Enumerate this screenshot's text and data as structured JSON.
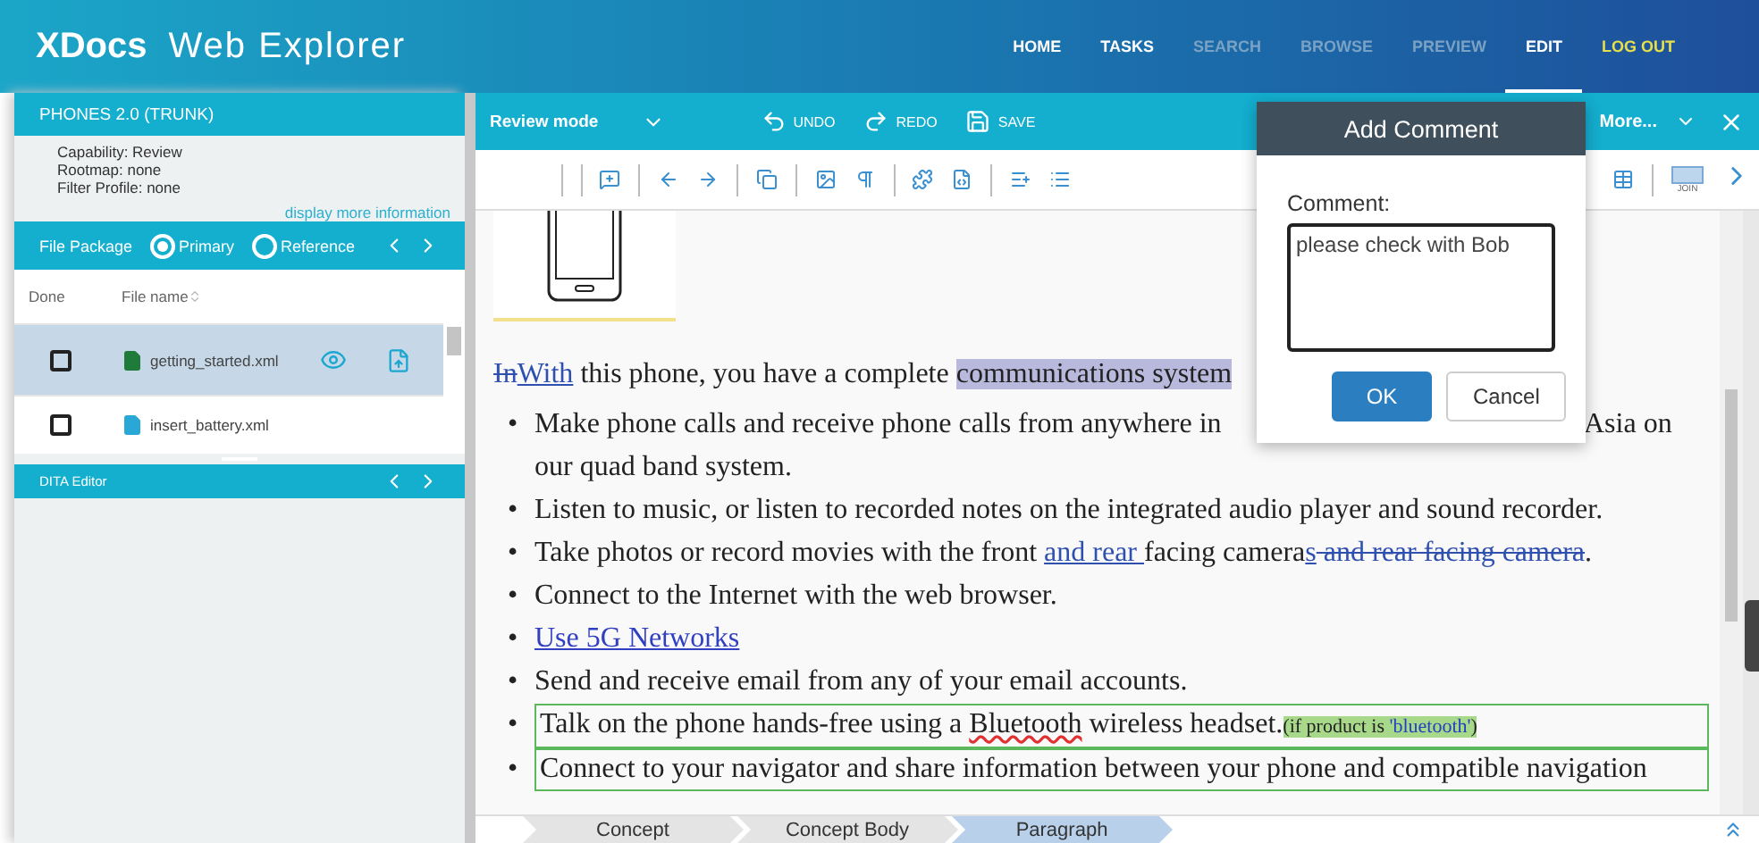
{
  "header": {
    "brand": "XDocs",
    "product": "Web Explorer",
    "nav": [
      {
        "label": "HOME",
        "selected": false,
        "disabled": false,
        "kind": "link"
      },
      {
        "label": "TASKS",
        "selected": false,
        "disabled": false,
        "kind": "link"
      },
      {
        "label": "SEARCH",
        "selected": false,
        "disabled": true,
        "kind": "link"
      },
      {
        "label": "BROWSE",
        "selected": false,
        "disabled": true,
        "kind": "link"
      },
      {
        "label": "PREVIEW",
        "selected": false,
        "disabled": true,
        "kind": "link"
      },
      {
        "label": "EDIT",
        "selected": true,
        "disabled": false,
        "kind": "link"
      },
      {
        "label": "LOG OUT",
        "selected": false,
        "disabled": false,
        "kind": "logout"
      }
    ]
  },
  "project": {
    "title": "PHONES 2.0 (TRUNK)",
    "info": [
      "Capability: Review",
      "Rootmap: none",
      "Filter Profile: none"
    ],
    "more_link": "display more information"
  },
  "file_package": {
    "label": "File Package",
    "options": [
      {
        "label": "Primary",
        "selected": true
      },
      {
        "label": "Reference",
        "selected": false
      }
    ]
  },
  "files": {
    "columns": [
      "Done",
      "File name"
    ],
    "rows": [
      {
        "name": "getting_started.xml",
        "done": false,
        "selected": true,
        "color": "#1e7b3a"
      },
      {
        "name": "insert_battery.xml",
        "done": false,
        "selected": false,
        "color": "#29a8d8"
      }
    ]
  },
  "dita_editor": {
    "title": "DITA Editor"
  },
  "editor_bar": {
    "mode": "Review mode",
    "actions": [
      {
        "label": "UNDO",
        "kind": "undo"
      },
      {
        "label": "REDO",
        "kind": "redo"
      },
      {
        "label": "SAVE",
        "kind": "save"
      }
    ],
    "more": "More..."
  },
  "toolbar": {
    "join": "JOIN"
  },
  "document": {
    "intro": [
      {
        "t": "In",
        "kind": "deleted"
      },
      {
        "t": "With",
        "kind": "inserted"
      },
      {
        "t": " this phone, you have a complete ",
        "kind": "plain"
      },
      {
        "t": "communications system",
        "kind": "highlight"
      }
    ],
    "bullets": [
      {
        "marker": "•",
        "boxed": false,
        "runs": [
          {
            "t": "Make phone calls and receive phone calls from anywhere in",
            "kind": "plain"
          }
        ],
        "after_dialog": [
          {
            "t": "Asia on our quad band system.",
            "kind": "plain"
          }
        ]
      },
      {
        "marker": "•",
        "boxed": false,
        "runs": [
          {
            "t": "Listen to music, or listen to recorded notes on the integrated audio player and sound recorder.",
            "kind": "plain"
          }
        ]
      },
      {
        "marker": "•",
        "boxed": false,
        "runs": [
          {
            "t": "Take photos or record movies with the front ",
            "kind": "plain"
          },
          {
            "t": "and rear ",
            "kind": "inserted"
          },
          {
            "t": "facing camera",
            "kind": "plain"
          },
          {
            "t": "s",
            "kind": "inserted"
          },
          {
            "t": " and rear facing camera",
            "kind": "deleted"
          },
          {
            "t": ".",
            "kind": "plain"
          }
        ]
      },
      {
        "marker": "•",
        "boxed": false,
        "runs": [
          {
            "t": "Connect to the Internet with the web browser.",
            "kind": "plain"
          }
        ]
      },
      {
        "marker": "•",
        "boxed": false,
        "runs": [
          {
            "t": "Use 5G Networks",
            "kind": "link"
          }
        ]
      },
      {
        "marker": "•",
        "boxed": false,
        "runs": [
          {
            "t": "Send and receive email from any of your email accounts.",
            "kind": "plain"
          }
        ]
      },
      {
        "marker": "•",
        "boxed": true,
        "runs": [
          {
            "t": "Talk on the phone hands-free using a ",
            "kind": "plain"
          },
          {
            "t": "Bluetooth",
            "kind": "misspelled"
          },
          {
            "t": " wireless headset.",
            "kind": "plain"
          },
          {
            "t": "(if product is ",
            "kind": "condition"
          },
          {
            "t": "'bluetooth'",
            "kind": "condition-value"
          },
          {
            "t": ")",
            "kind": "condition"
          }
        ]
      },
      {
        "marker": "•",
        "boxed": true,
        "runs": [
          {
            "t": "Connect to your navigator and share information between your phone and compatible navigation",
            "kind": "plain"
          }
        ]
      }
    ]
  },
  "dialog": {
    "title": "Add Comment",
    "label": "Comment:",
    "value": "please check with Bob",
    "buttons": [
      {
        "label": "OK",
        "kind": "primary"
      },
      {
        "label": "Cancel",
        "kind": "secondary"
      }
    ]
  },
  "breadcrumb": [
    {
      "label": "Concept",
      "selected": false
    },
    {
      "label": "Concept Body",
      "selected": false
    },
    {
      "label": "Paragraph",
      "selected": true
    }
  ]
}
